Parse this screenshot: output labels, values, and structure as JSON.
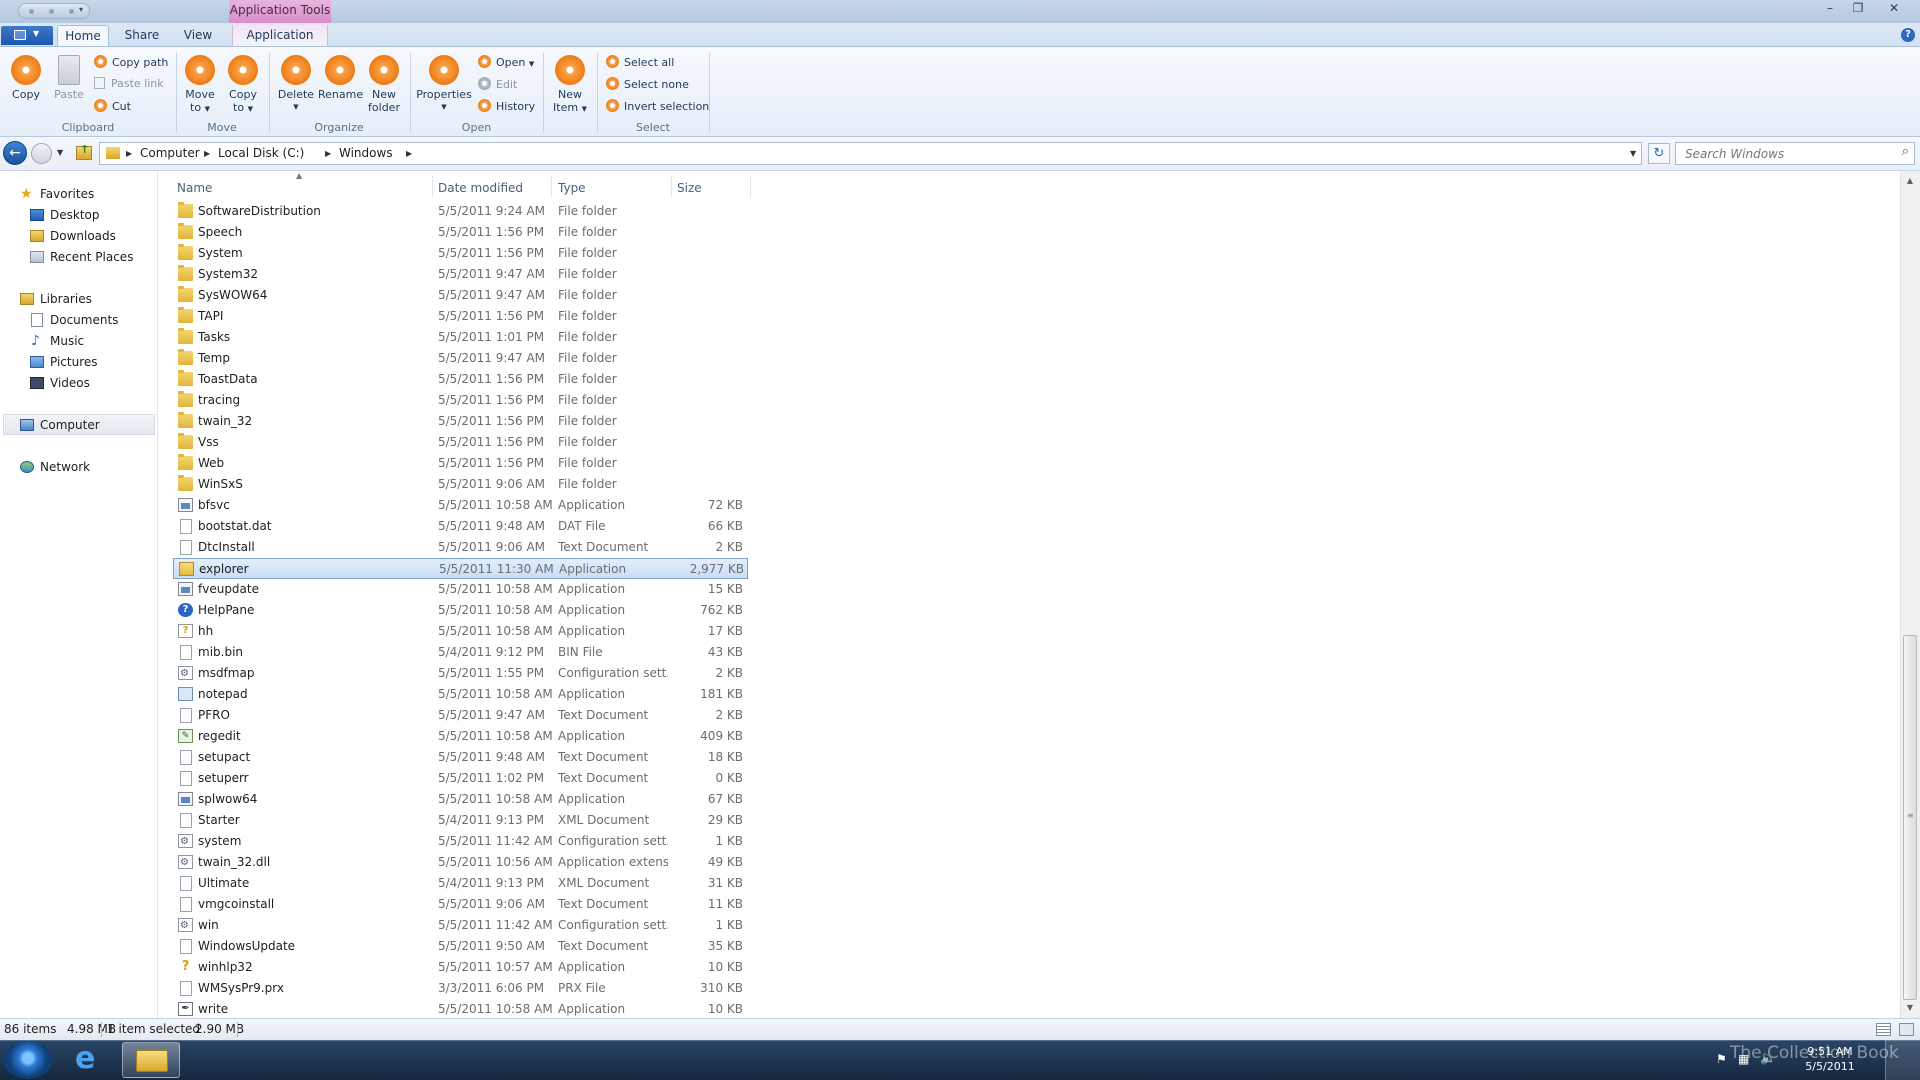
{
  "titlebar": {
    "contextual_tab_group": "Application Tools",
    "controls": {
      "minimize": "–",
      "maximize": "❐",
      "close": "✕"
    }
  },
  "ribbon_tabs": [
    "Home",
    "Share",
    "View",
    "Application"
  ],
  "ribbon": {
    "clipboard": {
      "copy": "Copy",
      "paste": "Paste",
      "copy_path": "Copy path",
      "paste_link": "Paste link",
      "cut": "Cut",
      "label": "Clipboard"
    },
    "move": {
      "move_to": [
        "Move",
        "to"
      ],
      "copy_to": [
        "Copy",
        "to"
      ],
      "label": "Move"
    },
    "organize": {
      "delete": "Delete",
      "rename": "Rename",
      "new_folder": [
        "New",
        "folder"
      ],
      "label": "Organize"
    },
    "open": {
      "properties": "Properties",
      "open": "Open",
      "edit": "Edit",
      "history": "History",
      "label": "Open"
    },
    "new": {
      "new_item": [
        "New",
        "Item"
      ]
    },
    "select": {
      "select_all": "Select all",
      "select_none": "Select none",
      "invert_selection": "Invert selection",
      "label": "Select"
    }
  },
  "address": {
    "breadcrumb": [
      "Computer",
      "Local Disk (C:)",
      "Windows"
    ],
    "search_placeholder": "Search Windows"
  },
  "nav": {
    "favorites": {
      "label": "Favorites",
      "items": [
        "Desktop",
        "Downloads",
        "Recent Places"
      ]
    },
    "libraries": {
      "label": "Libraries",
      "items": [
        "Documents",
        "Music",
        "Pictures",
        "Videos"
      ]
    },
    "computer": "Computer",
    "network": "Network"
  },
  "columns": {
    "name": "Name",
    "date": "Date modified",
    "type": "Type",
    "size": "Size"
  },
  "files": [
    {
      "name": "SoftwareDistribution",
      "date": "5/5/2011 9:24 AM",
      "type": "File folder",
      "size": "",
      "icon": "folder"
    },
    {
      "name": "Speech",
      "date": "5/5/2011 1:56 PM",
      "type": "File folder",
      "size": "",
      "icon": "folder"
    },
    {
      "name": "System",
      "date": "5/5/2011 1:56 PM",
      "type": "File folder",
      "size": "",
      "icon": "folder"
    },
    {
      "name": "System32",
      "date": "5/5/2011 9:47 AM",
      "type": "File folder",
      "size": "",
      "icon": "folder"
    },
    {
      "name": "SysWOW64",
      "date": "5/5/2011 9:47 AM",
      "type": "File folder",
      "size": "",
      "icon": "folder"
    },
    {
      "name": "TAPI",
      "date": "5/5/2011 1:56 PM",
      "type": "File folder",
      "size": "",
      "icon": "folder"
    },
    {
      "name": "Tasks",
      "date": "5/5/2011 1:01 PM",
      "type": "File folder",
      "size": "",
      "icon": "folder"
    },
    {
      "name": "Temp",
      "date": "5/5/2011 9:47 AM",
      "type": "File folder",
      "size": "",
      "icon": "folder"
    },
    {
      "name": "ToastData",
      "date": "5/5/2011 1:56 PM",
      "type": "File folder",
      "size": "",
      "icon": "folder"
    },
    {
      "name": "tracing",
      "date": "5/5/2011 1:56 PM",
      "type": "File folder",
      "size": "",
      "icon": "folder"
    },
    {
      "name": "twain_32",
      "date": "5/5/2011 1:56 PM",
      "type": "File folder",
      "size": "",
      "icon": "folder"
    },
    {
      "name": "Vss",
      "date": "5/5/2011 1:56 PM",
      "type": "File folder",
      "size": "",
      "icon": "folder"
    },
    {
      "name": "Web",
      "date": "5/5/2011 1:56 PM",
      "type": "File folder",
      "size": "",
      "icon": "folder"
    },
    {
      "name": "WinSxS",
      "date": "5/5/2011 9:06 AM",
      "type": "File folder",
      "size": "",
      "icon": "folder"
    },
    {
      "name": "bfsvc",
      "date": "5/5/2011 10:58 AM",
      "type": "Application",
      "size": "72 KB",
      "icon": "app"
    },
    {
      "name": "bootstat.dat",
      "date": "5/5/2011 9:48 AM",
      "type": "DAT File",
      "size": "66 KB",
      "icon": "file"
    },
    {
      "name": "DtcInstall",
      "date": "5/5/2011 9:06 AM",
      "type": "Text Document",
      "size": "2 KB",
      "icon": "file"
    },
    {
      "name": "explorer",
      "date": "5/5/2011 11:30 AM",
      "type": "Application",
      "size": "2,977 KB",
      "icon": "explorer",
      "selected": true
    },
    {
      "name": "fveupdate",
      "date": "5/5/2011 10:58 AM",
      "type": "Application",
      "size": "15 KB",
      "icon": "app"
    },
    {
      "name": "HelpPane",
      "date": "5/5/2011 10:58 AM",
      "type": "Application",
      "size": "762 KB",
      "icon": "help"
    },
    {
      "name": "hh",
      "date": "5/5/2011 10:58 AM",
      "type": "Application",
      "size": "17 KB",
      "icon": "hh"
    },
    {
      "name": "mib.bin",
      "date": "5/4/2011 9:12 PM",
      "type": "BIN File",
      "size": "43 KB",
      "icon": "file"
    },
    {
      "name": "msdfmap",
      "date": "5/5/2011 1:55 PM",
      "type": "Configuration sett...",
      "size": "2 KB",
      "icon": "cfg"
    },
    {
      "name": "notepad",
      "date": "5/5/2011 10:58 AM",
      "type": "Application",
      "size": "181 KB",
      "icon": "note"
    },
    {
      "name": "PFRO",
      "date": "5/5/2011 9:47 AM",
      "type": "Text Document",
      "size": "2 KB",
      "icon": "file"
    },
    {
      "name": "regedit",
      "date": "5/5/2011 10:58 AM",
      "type": "Application",
      "size": "409 KB",
      "icon": "reg"
    },
    {
      "name": "setupact",
      "date": "5/5/2011 9:48 AM",
      "type": "Text Document",
      "size": "18 KB",
      "icon": "file"
    },
    {
      "name": "setuperr",
      "date": "5/5/2011 1:02 PM",
      "type": "Text Document",
      "size": "0 KB",
      "icon": "file"
    },
    {
      "name": "splwow64",
      "date": "5/5/2011 10:58 AM",
      "type": "Application",
      "size": "67 KB",
      "icon": "app"
    },
    {
      "name": "Starter",
      "date": "5/4/2011 9:13 PM",
      "type": "XML Document",
      "size": "29 KB",
      "icon": "file"
    },
    {
      "name": "system",
      "date": "5/5/2011 11:42 AM",
      "type": "Configuration sett...",
      "size": "1 KB",
      "icon": "cfg"
    },
    {
      "name": "twain_32.dll",
      "date": "5/5/2011 10:56 AM",
      "type": "Application extens...",
      "size": "49 KB",
      "icon": "cfg"
    },
    {
      "name": "Ultimate",
      "date": "5/4/2011 9:13 PM",
      "type": "XML Document",
      "size": "31 KB",
      "icon": "file"
    },
    {
      "name": "vmgcoinstall",
      "date": "5/5/2011 9:06 AM",
      "type": "Text Document",
      "size": "11 KB",
      "icon": "file"
    },
    {
      "name": "win",
      "date": "5/5/2011 11:42 AM",
      "type": "Configuration sett...",
      "size": "1 KB",
      "icon": "cfg"
    },
    {
      "name": "WindowsUpdate",
      "date": "5/5/2011 9:50 AM",
      "type": "Text Document",
      "size": "35 KB",
      "icon": "file"
    },
    {
      "name": "winhlp32",
      "date": "5/5/2011 10:57 AM",
      "type": "Application",
      "size": "10 KB",
      "icon": "winhlp"
    },
    {
      "name": "WMSysPr9.prx",
      "date": "3/3/2011 6:06 PM",
      "type": "PRX File",
      "size": "310 KB",
      "icon": "file"
    },
    {
      "name": "write",
      "date": "5/5/2011 10:58 AM",
      "type": "Application",
      "size": "10 KB",
      "icon": "write"
    }
  ],
  "status": {
    "items": "86 items",
    "total_size": "4.98 MB",
    "selection": "1 item selected",
    "selection_size": "2.90 MB"
  },
  "taskbar": {
    "watermark": "The Collection Book",
    "time": "9:51 AM",
    "date": "5/5/2011"
  }
}
